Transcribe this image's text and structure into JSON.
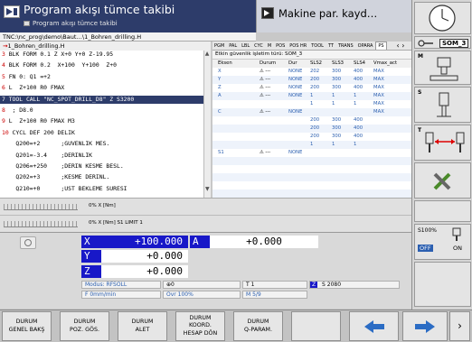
{
  "header": {
    "title": "Program akışı tümce takibi",
    "subtitle": "Program akışı tümce takibi",
    "right_title": "Makine par. kayd…"
  },
  "program": {
    "path": "TNC:\\nc_prog\\demo\\Baut…\\1_Bohren_drilling.H",
    "file": "1_Bohren_drilling.H",
    "lines": [
      [
        "3",
        " BLK FORM 0.1 Z X+0 Y+0 Z-19.95"
      ],
      [
        "4",
        " BLK FORM 0.2  X+100  Y+100  Z+0"
      ],
      [
        "5",
        " FN 0: Q1 =+2"
      ],
      [
        "6",
        " L  Z+100 R0 FMAX"
      ],
      [
        "7",
        " TOOL CALL \"NC_SPOT_DRILL_D8\" Z S3200"
      ],
      [
        "8",
        "  ; D8.0"
      ],
      [
        "9",
        " L  Z+100 R0 FMAX M3"
      ],
      [
        "10",
        " CYCL DEF 200 DELIK"
      ],
      [
        "",
        "    Q200=+2      ;GUVENLIK MES."
      ],
      [
        "",
        "    Q201=-3.4    ;DERINLIK"
      ],
      [
        "",
        "    Q206=+250    ;DERIN KESME BESL."
      ],
      [
        "",
        "    Q202=+3      ;KESME DERINL."
      ],
      [
        "",
        "    Q210=+0      ;UST BEKLEME SURESI"
      ]
    ],
    "selected_index": 4
  },
  "tabs": [
    "PGM",
    "PAL",
    "LBL",
    "CYC",
    "M",
    "POS",
    "POS HR",
    "TOOL",
    "TT",
    "TRANS",
    "OPARA",
    "PS"
  ],
  "active_tab": "PS",
  "table": {
    "title": "Etkin güvenlik işletim türü: SOM_3",
    "headers": [
      "Eksen",
      "Durum",
      "Dur",
      "SLS2",
      "SLS3",
      "SLS4",
      "Vmax_act"
    ],
    "rows": [
      [
        "X",
        "⚠ ---",
        "NONE",
        "202",
        "300",
        "400",
        "MAX"
      ],
      [
        "Y",
        "⚠ ---",
        "NONE",
        "200",
        "300",
        "400",
        "MAX"
      ],
      [
        "Z",
        "⚠ ---",
        "NONE",
        "200",
        "300",
        "400",
        "MAX"
      ],
      [
        "A",
        "⚠ ---",
        "NONE",
        "1",
        "1",
        "1",
        "MAX"
      ],
      [
        "",
        "",
        "",
        "1",
        "1",
        "1",
        "MAX"
      ],
      [
        "C",
        "⚠ ---",
        "NONE",
        "",
        "",
        "",
        "MAX"
      ],
      [
        "",
        "",
        "",
        "200",
        "300",
        "400",
        ""
      ],
      [
        "",
        "",
        "",
        "200",
        "300",
        "400",
        ""
      ],
      [
        "",
        "",
        "",
        "200",
        "300",
        "400",
        ""
      ],
      [
        "",
        "",
        "",
        "1",
        "1",
        "1",
        ""
      ],
      [
        "S1",
        "⚠ ---",
        "NONE",
        "",
        "",
        "",
        ""
      ],
      [
        "",
        "",
        "",
        "",
        "",
        "",
        ""
      ],
      [
        "",
        "",
        "",
        "",
        "",
        "",
        ""
      ],
      [
        "",
        "",
        "",
        "",
        "",
        "",
        ""
      ],
      [
        "",
        "",
        "",
        "",
        "",
        "",
        ""
      ],
      [
        "",
        "",
        "",
        "",
        "",
        "",
        ""
      ]
    ]
  },
  "feed": {
    "bar1_label": "0% X [Nm]",
    "bar2_label": "0% X [Nm]  S1    LIMIT 1"
  },
  "positions": {
    "axes": [
      {
        "label": "X",
        "value": "+100.000"
      },
      {
        "label": "Y",
        "value": "+0.000"
      },
      {
        "label": "Z",
        "value": "+0.000"
      }
    ],
    "a_label": "A",
    "a_value": "+0.000"
  },
  "status": {
    "modus": "Modus: RFSOLL",
    "feed": "F 0mm/min",
    "zero": "0",
    "ovr": "Ovr 100%",
    "tool": "T 1",
    "m": "M 5/9",
    "spindle_axis": "Z",
    "speed": "S 2080"
  },
  "side": {
    "som": "SOM_3",
    "m": "M",
    "s": "S",
    "t": "T",
    "s100": "S100%",
    "off": "OFF",
    "on": "ON"
  },
  "softkeys": [
    "DURUM\nGENEL BAKŞ",
    "DURUM\nPOZ. GÖS.",
    "DURUM\nALET",
    "DURUM\nKOORD.\nHESAP DÖN",
    "DURUM\nQ-PARAM."
  ],
  "colors": {
    "header_bg": "#2d3c6a",
    "axis_blue": "#1818c8",
    "accent_blue": "#2b5fb0"
  }
}
